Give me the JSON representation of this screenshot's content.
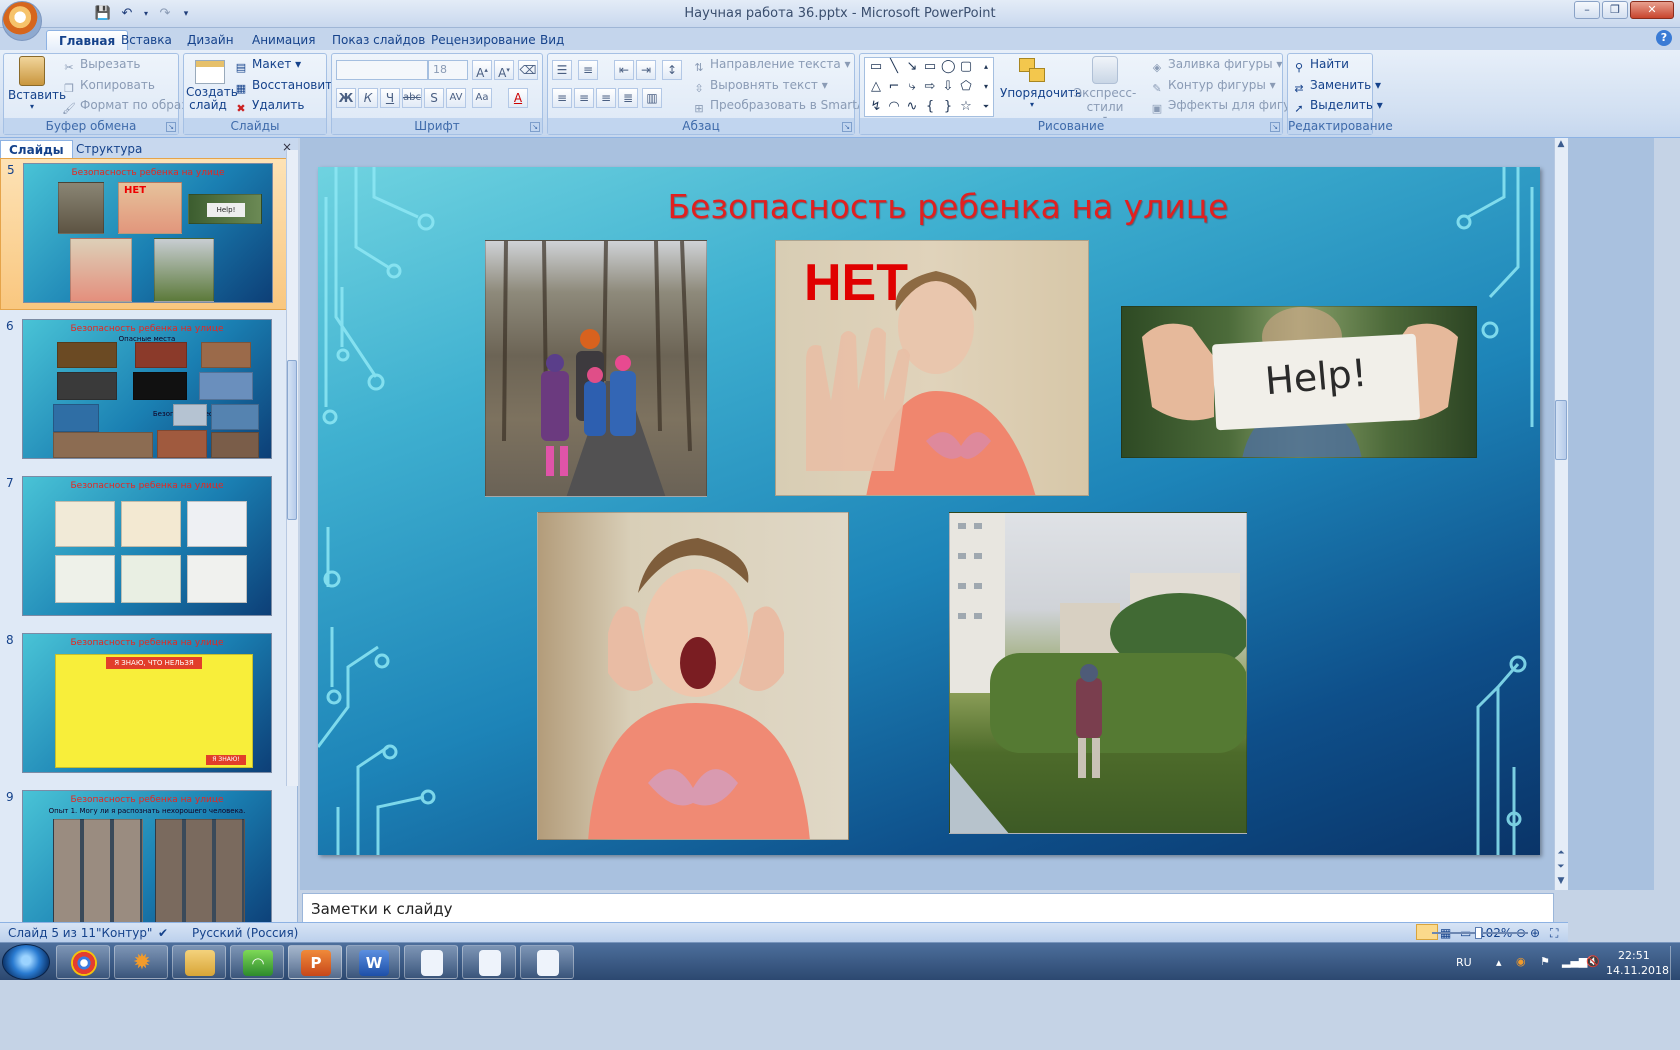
{
  "window": {
    "title": "Научная работа 36.pptx - Microsoft PowerPoint"
  },
  "qat": {
    "save_icon": "save-icon",
    "undo_icon": "undo-icon",
    "redo_icon": "redo-icon"
  },
  "tabs": [
    "Главная",
    "Вставка",
    "Дизайн",
    "Анимация",
    "Показ слайдов",
    "Рецензирование",
    "Вид"
  ],
  "ribbon": {
    "clipboard": {
      "label": "Буфер обмена",
      "paste": "Вставить",
      "cut": "Вырезать",
      "copy": "Копировать",
      "format": "Формат по образцу"
    },
    "slides": {
      "label": "Слайды",
      "new_slide": "Создать слайд",
      "layout": "Макет",
      "reset": "Восстановить",
      "delete": "Удалить"
    },
    "font": {
      "label": "Шрифт",
      "font_name": "",
      "font_size": "18"
    },
    "paragraph": {
      "label": "Абзац",
      "text_direction": "Направление текста",
      "align_text": "Выровнять текст",
      "smartart": "Преобразовать в SmartArt"
    },
    "drawing": {
      "label": "Рисование",
      "arrange": "Упорядочить",
      "quick_styles": "Экспресс-стили",
      "shape_fill": "Заливка фигуры",
      "shape_outline": "Контур фигуры",
      "shape_effects": "Эффекты для фигур"
    },
    "editing": {
      "label": "Редактирование",
      "find": "Найти",
      "replace": "Заменить",
      "select": "Выделить"
    }
  },
  "pane": {
    "tab_slides": "Слайды",
    "tab_outline": "Структура",
    "close": "×",
    "thumbs": [
      {
        "num": "5",
        "title": "Безопасность ребенка на улице",
        "net": "НЕТ",
        "help": "Help!"
      },
      {
        "num": "6",
        "title": "Безопасность ребенка на улице",
        "sub1": "Опасные места",
        "sub2": "Безопасные места"
      },
      {
        "num": "7",
        "title": "Безопасность ребенка на улице"
      },
      {
        "num": "8",
        "title": "Безопасность ребенка на улице",
        "banner": "Я ЗНАЮ, ЧТО НЕЛЬЗЯ",
        "badge": "Я ЗНАЮ!"
      },
      {
        "num": "9",
        "title": "Безопасность ребенка на улице",
        "sub1": "Опыт 1. Могу ли я распознать нехорошего человека."
      }
    ]
  },
  "slide": {
    "title": "Безопасность ребенка на улице",
    "net": "НЕТ",
    "help": "Help!"
  },
  "notes": {
    "placeholder": "Заметки к слайду"
  },
  "status": {
    "slide_of": "Слайд 5 из 11",
    "theme": "\"Контур\"",
    "language": "Русский (Россия)",
    "zoom": "102%"
  },
  "tray": {
    "lang": "RU",
    "time": "22:51",
    "date": "14.11.2018"
  },
  "colors": {
    "title_red": "#e02020",
    "accent": "#15428b"
  }
}
